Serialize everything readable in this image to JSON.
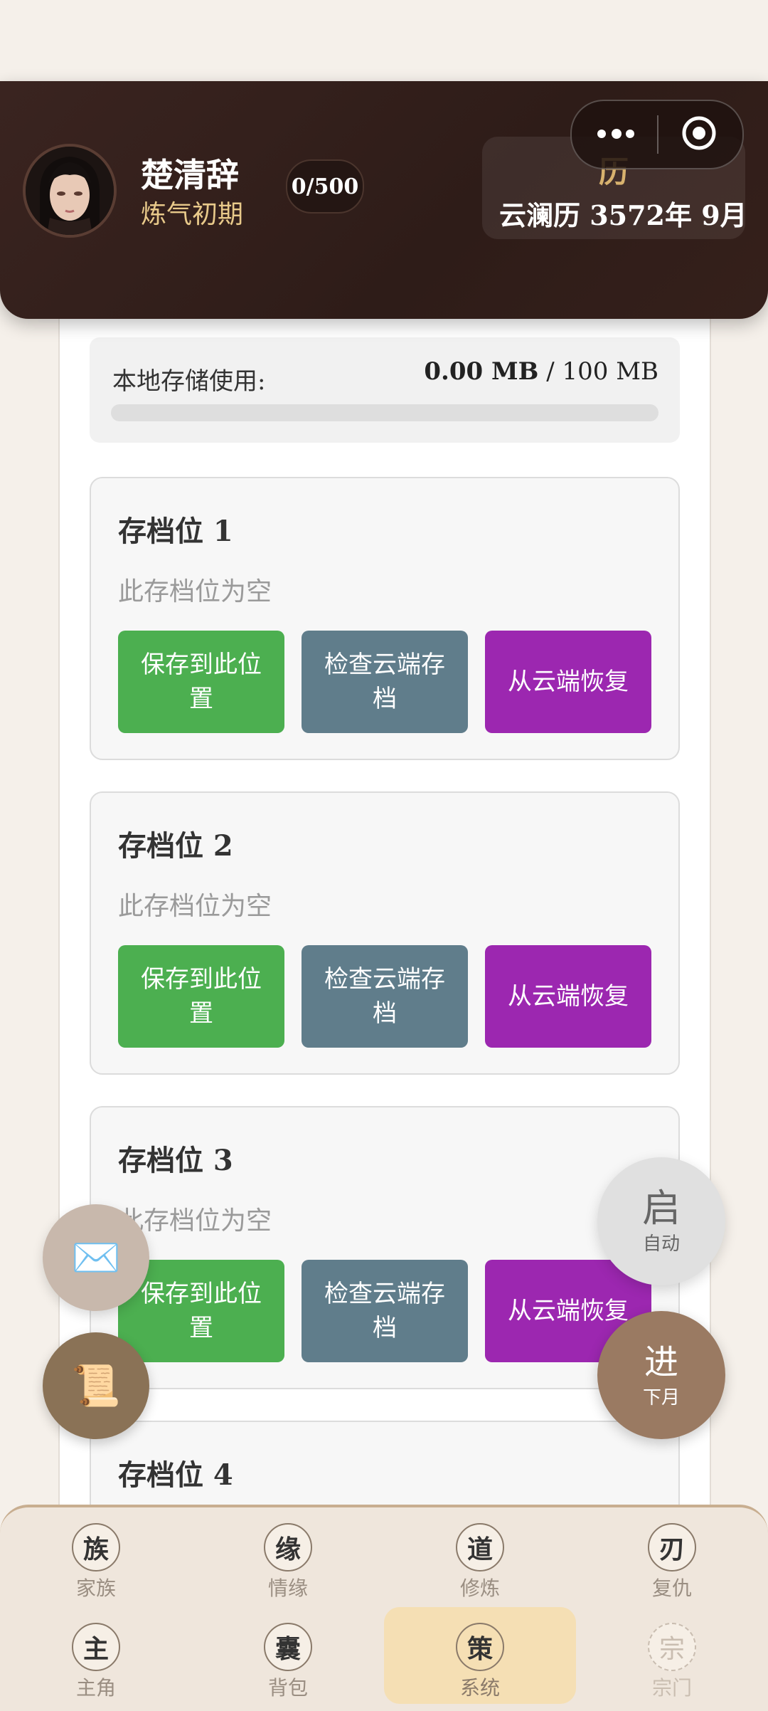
{
  "header": {
    "character_name": "楚清辞",
    "realm": "炼气初期",
    "exp": "0/500",
    "calendar_icon": "历",
    "calendar_date": "云澜历 3572年 9月"
  },
  "storage": {
    "label": "本地存储使用:",
    "used": "0.00 MB",
    "separator": " / ",
    "total": "100 MB",
    "fraction": 0
  },
  "slots": [
    {
      "title": "存档位 1",
      "status": "此存档位为空",
      "save": "保存到此位置",
      "check": "检查云端存档",
      "restore": "从云端恢复"
    },
    {
      "title": "存档位 2",
      "status": "此存档位为空",
      "save": "保存到此位置",
      "check": "检查云端存档",
      "restore": "从云端恢复"
    },
    {
      "title": "存档位 3",
      "status": "此存档位为空",
      "save": "保存到此位置",
      "check": "检查云端存档",
      "restore": "从云端恢复"
    },
    {
      "title": "存档位 4",
      "status": "",
      "save": "",
      "check": "",
      "restore": ""
    }
  ],
  "fabs": {
    "mail_icon": "✉️",
    "scroll_icon": "📜",
    "auto_main": "启",
    "auto_sub": "自动",
    "next_main": "进",
    "next_sub": "下月"
  },
  "tabs": [
    {
      "icon": "族",
      "label": "家族"
    },
    {
      "icon": "缘",
      "label": "情缘"
    },
    {
      "icon": "道",
      "label": "修炼"
    },
    {
      "icon": "刃",
      "label": "复仇"
    },
    {
      "icon": "主",
      "label": "主角"
    },
    {
      "icon": "囊",
      "label": "背包"
    },
    {
      "icon": "策",
      "label": "系统"
    },
    {
      "icon": "宗",
      "label": "宗门"
    }
  ],
  "colors": {
    "header_bg": "#2e1c18",
    "save_button": "#4caf50",
    "check_button": "#607d8b",
    "restore_button": "#9c27b0",
    "active_tab": "#f5dfb4"
  }
}
